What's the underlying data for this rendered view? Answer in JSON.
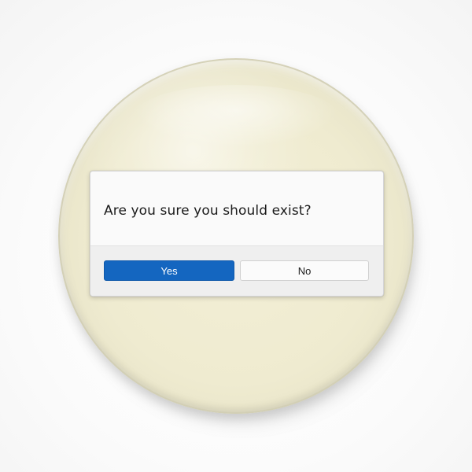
{
  "dialog": {
    "message": "Are you sure you should exist?",
    "yes_label": "Yes",
    "no_label": "No"
  },
  "colors": {
    "pin_face": "#efebd0",
    "primary_button": "#1466c0",
    "dialog_background": "#fafafa",
    "dialog_footer": "#efefef"
  }
}
